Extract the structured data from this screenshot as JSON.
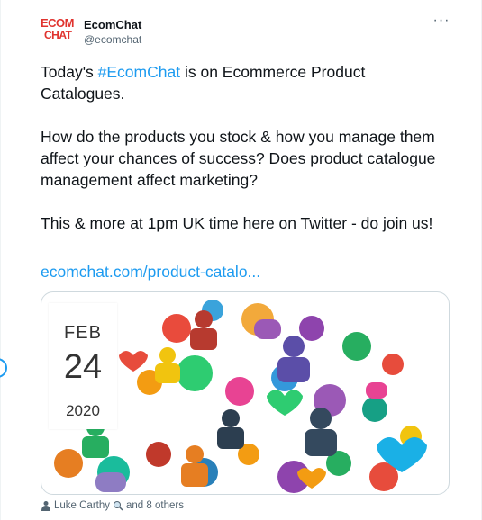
{
  "tweet": {
    "avatar": {
      "line1": "ECOM",
      "line2": "CHAT"
    },
    "author_name": "EcomChat",
    "author_handle": "@ecomchat",
    "more_label": "···",
    "paragraph1_pre": "Today's ",
    "hashtag": "#EcomChat",
    "paragraph1_post": " is on Ecommerce Product Catalogues.",
    "paragraph2": "How do the products you stock & how you manage them affect your chances of success? Does product catalogue management affect marketing?",
    "paragraph3": "This & more at 1pm UK time here on Twitter - do join us!",
    "link_text": "ecomchat.com/product-catalo...",
    "media": {
      "date_month": "FEB",
      "date_day": "24",
      "date_year": "2020"
    },
    "tagged_text": "Luke Carthy",
    "tagged_more": "and 8 others",
    "icons": [
      "person-icon",
      "search-icon",
      "more-icon"
    ]
  },
  "colors": {
    "link": "#1d9bf0",
    "text": "#0f1419",
    "muted": "#536471",
    "brand_red": "#e0332e"
  }
}
